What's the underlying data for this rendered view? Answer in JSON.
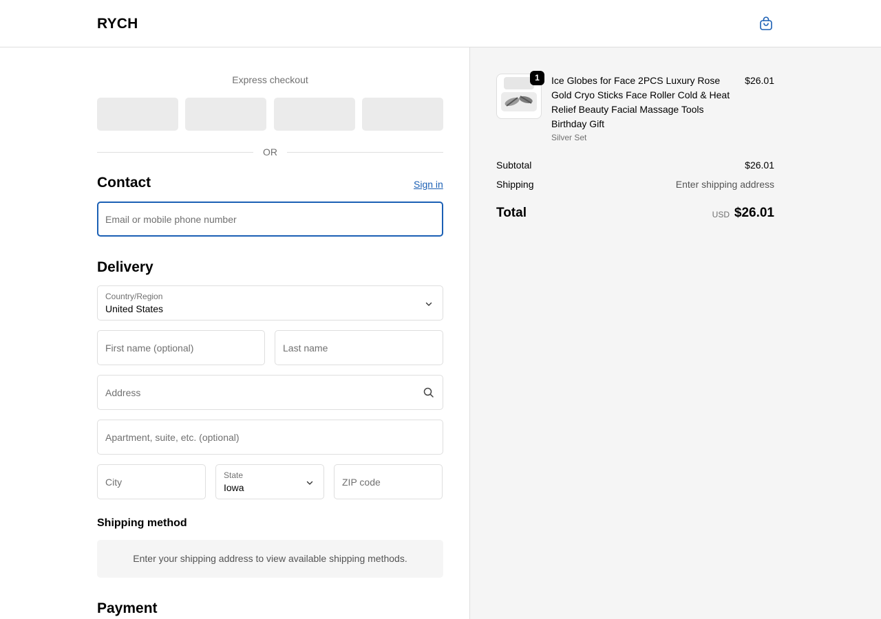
{
  "header": {
    "logo": "RYCH",
    "cart_icon": "shopping-bag-icon",
    "accent_color": "#1a5fb4"
  },
  "express": {
    "title": "Express checkout",
    "divider": "OR"
  },
  "contact": {
    "title": "Contact",
    "sign_in": "Sign in",
    "email_placeholder": "Email or mobile phone number"
  },
  "delivery": {
    "title": "Delivery",
    "country_label": "Country/Region",
    "country_value": "United States",
    "first_name_placeholder": "First name (optional)",
    "last_name_placeholder": "Last name",
    "address_placeholder": "Address",
    "apartment_placeholder": "Apartment, suite, etc. (optional)",
    "city_placeholder": "City",
    "state_label": "State",
    "state_value": "Iowa",
    "zip_placeholder": "ZIP code"
  },
  "shipping_method": {
    "title": "Shipping method",
    "message": "Enter your shipping address to view available shipping methods."
  },
  "payment": {
    "title": "Payment"
  },
  "order_summary": {
    "item": {
      "quantity": "1",
      "title": "Ice Globes for Face 2PCS Luxury Rose Gold Cryo Sticks Face Roller Cold & Heat Relief Beauty Facial Massage Tools Birthday Gift",
      "variant": "Silver Set",
      "price": "$26.01"
    },
    "subtotal_label": "Subtotal",
    "subtotal_value": "$26.01",
    "shipping_label": "Shipping",
    "shipping_value": "Enter shipping address",
    "total_label": "Total",
    "total_currency": "USD",
    "total_value": "$26.01"
  }
}
